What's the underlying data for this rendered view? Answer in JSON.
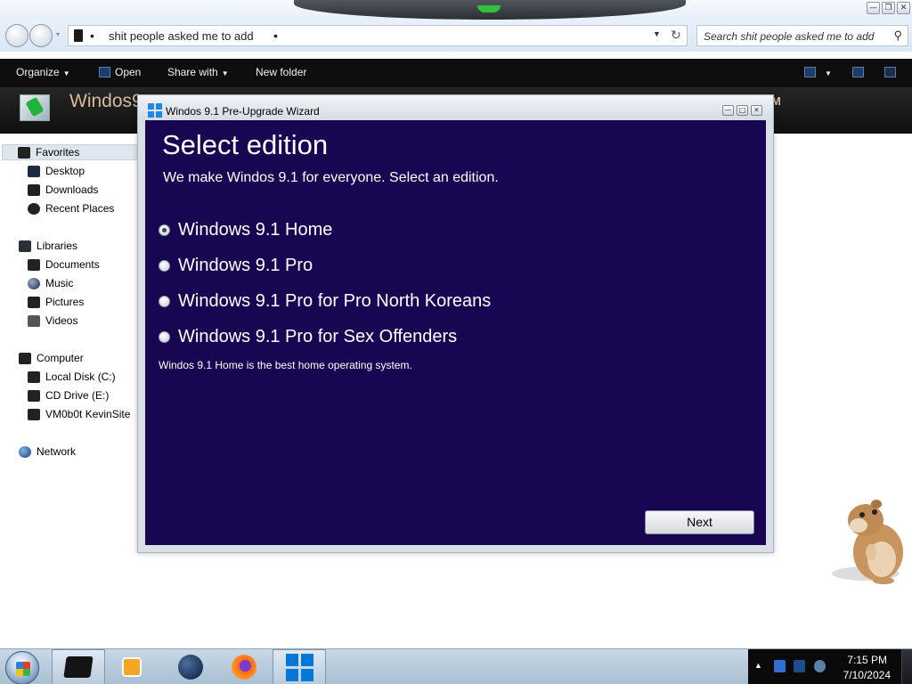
{
  "explorer": {
    "address_path": "shit people asked me to add",
    "search_placeholder": "Search shit people asked me to add",
    "toolbar": {
      "organize": "Organize",
      "open": "Open",
      "share_with": "Share with",
      "new_folder": "New folder"
    },
    "header_title": "Windos9.",
    "header_tail": "M",
    "nav": {
      "favorites": "Favorites",
      "desktop": "Desktop",
      "downloads": "Downloads",
      "recent_places": "Recent Places",
      "libraries": "Libraries",
      "documents": "Documents",
      "music": "Music",
      "pictures": "Pictures",
      "videos": "Videos",
      "computer": "Computer",
      "local_disk": "Local Disk (C:)",
      "cd_drive": "CD Drive (E:)",
      "vm_share": "VM0b0t KevinSite",
      "network": "Network"
    }
  },
  "wizard": {
    "window_title": "Windos 9.1 Pre-Upgrade Wizard",
    "heading": "Select edition",
    "subtitle": "We make Windos 9.1 for everyone. Select an edition.",
    "options": [
      {
        "label": "Windows 9.1 Home",
        "selected": true
      },
      {
        "label": "Windows 9.1 Pro",
        "selected": false
      },
      {
        "label": "Windows 9.1 Pro for Pro North Koreans",
        "selected": false
      },
      {
        "label": "Windows 9.1 Pro for Sex Offenders",
        "selected": false
      }
    ],
    "description": "Windos 9.1 Home is the best home operating system.",
    "next_label": "Next"
  },
  "taskbar": {
    "time": "7:15 PM",
    "date": "7/10/2024"
  },
  "icons": [
    "back-icon",
    "forward-icon",
    "folder-icon",
    "search-icon",
    "refresh-icon",
    "windows-logo-icon",
    "hamster-image",
    "firefox-icon",
    "globe-icon",
    "media-player-icon"
  ],
  "colors": {
    "wizard_background": "#180652",
    "toolbar_background": "#0e0e0e",
    "header_text": "#d9b99b",
    "taskbar": "#b9cbdc"
  }
}
